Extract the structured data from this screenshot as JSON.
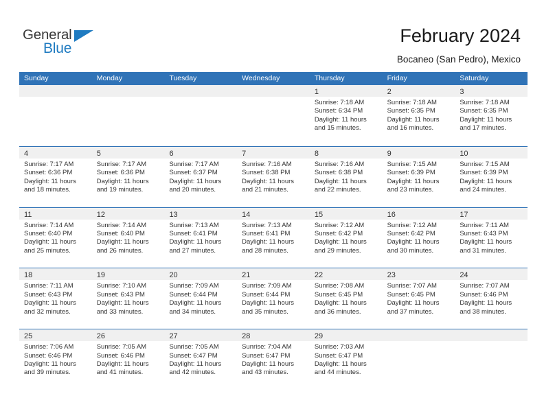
{
  "logo": {
    "word_top": "General",
    "word_bottom": "Blue",
    "accent_color": "#1f7bc1"
  },
  "header": {
    "title": "February 2024",
    "subtitle": "Bocaneo (San Pedro), Mexico"
  },
  "theme": {
    "header_blue": "#3073b7",
    "day_band_gray": "#f0f0f0",
    "text": "#333333"
  },
  "calendar": {
    "weekday_headers": [
      "Sunday",
      "Monday",
      "Tuesday",
      "Wednesday",
      "Thursday",
      "Friday",
      "Saturday"
    ],
    "weeks": [
      [
        {
          "day": "",
          "empty": true
        },
        {
          "day": "",
          "empty": true
        },
        {
          "day": "",
          "empty": true
        },
        {
          "day": "",
          "empty": true
        },
        {
          "day": "1",
          "sunrise": "Sunrise: 7:18 AM",
          "sunset": "Sunset: 6:34 PM",
          "daylight_1": "Daylight: 11 hours",
          "daylight_2": "and 15 minutes."
        },
        {
          "day": "2",
          "sunrise": "Sunrise: 7:18 AM",
          "sunset": "Sunset: 6:35 PM",
          "daylight_1": "Daylight: 11 hours",
          "daylight_2": "and 16 minutes."
        },
        {
          "day": "3",
          "sunrise": "Sunrise: 7:18 AM",
          "sunset": "Sunset: 6:35 PM",
          "daylight_1": "Daylight: 11 hours",
          "daylight_2": "and 17 minutes."
        }
      ],
      [
        {
          "day": "4",
          "sunrise": "Sunrise: 7:17 AM",
          "sunset": "Sunset: 6:36 PM",
          "daylight_1": "Daylight: 11 hours",
          "daylight_2": "and 18 minutes."
        },
        {
          "day": "5",
          "sunrise": "Sunrise: 7:17 AM",
          "sunset": "Sunset: 6:36 PM",
          "daylight_1": "Daylight: 11 hours",
          "daylight_2": "and 19 minutes."
        },
        {
          "day": "6",
          "sunrise": "Sunrise: 7:17 AM",
          "sunset": "Sunset: 6:37 PM",
          "daylight_1": "Daylight: 11 hours",
          "daylight_2": "and 20 minutes."
        },
        {
          "day": "7",
          "sunrise": "Sunrise: 7:16 AM",
          "sunset": "Sunset: 6:38 PM",
          "daylight_1": "Daylight: 11 hours",
          "daylight_2": "and 21 minutes."
        },
        {
          "day": "8",
          "sunrise": "Sunrise: 7:16 AM",
          "sunset": "Sunset: 6:38 PM",
          "daylight_1": "Daylight: 11 hours",
          "daylight_2": "and 22 minutes."
        },
        {
          "day": "9",
          "sunrise": "Sunrise: 7:15 AM",
          "sunset": "Sunset: 6:39 PM",
          "daylight_1": "Daylight: 11 hours",
          "daylight_2": "and 23 minutes."
        },
        {
          "day": "10",
          "sunrise": "Sunrise: 7:15 AM",
          "sunset": "Sunset: 6:39 PM",
          "daylight_1": "Daylight: 11 hours",
          "daylight_2": "and 24 minutes."
        }
      ],
      [
        {
          "day": "11",
          "sunrise": "Sunrise: 7:14 AM",
          "sunset": "Sunset: 6:40 PM",
          "daylight_1": "Daylight: 11 hours",
          "daylight_2": "and 25 minutes."
        },
        {
          "day": "12",
          "sunrise": "Sunrise: 7:14 AM",
          "sunset": "Sunset: 6:40 PM",
          "daylight_1": "Daylight: 11 hours",
          "daylight_2": "and 26 minutes."
        },
        {
          "day": "13",
          "sunrise": "Sunrise: 7:13 AM",
          "sunset": "Sunset: 6:41 PM",
          "daylight_1": "Daylight: 11 hours",
          "daylight_2": "and 27 minutes."
        },
        {
          "day": "14",
          "sunrise": "Sunrise: 7:13 AM",
          "sunset": "Sunset: 6:41 PM",
          "daylight_1": "Daylight: 11 hours",
          "daylight_2": "and 28 minutes."
        },
        {
          "day": "15",
          "sunrise": "Sunrise: 7:12 AM",
          "sunset": "Sunset: 6:42 PM",
          "daylight_1": "Daylight: 11 hours",
          "daylight_2": "and 29 minutes."
        },
        {
          "day": "16",
          "sunrise": "Sunrise: 7:12 AM",
          "sunset": "Sunset: 6:42 PM",
          "daylight_1": "Daylight: 11 hours",
          "daylight_2": "and 30 minutes."
        },
        {
          "day": "17",
          "sunrise": "Sunrise: 7:11 AM",
          "sunset": "Sunset: 6:43 PM",
          "daylight_1": "Daylight: 11 hours",
          "daylight_2": "and 31 minutes."
        }
      ],
      [
        {
          "day": "18",
          "sunrise": "Sunrise: 7:11 AM",
          "sunset": "Sunset: 6:43 PM",
          "daylight_1": "Daylight: 11 hours",
          "daylight_2": "and 32 minutes."
        },
        {
          "day": "19",
          "sunrise": "Sunrise: 7:10 AM",
          "sunset": "Sunset: 6:43 PM",
          "daylight_1": "Daylight: 11 hours",
          "daylight_2": "and 33 minutes."
        },
        {
          "day": "20",
          "sunrise": "Sunrise: 7:09 AM",
          "sunset": "Sunset: 6:44 PM",
          "daylight_1": "Daylight: 11 hours",
          "daylight_2": "and 34 minutes."
        },
        {
          "day": "21",
          "sunrise": "Sunrise: 7:09 AM",
          "sunset": "Sunset: 6:44 PM",
          "daylight_1": "Daylight: 11 hours",
          "daylight_2": "and 35 minutes."
        },
        {
          "day": "22",
          "sunrise": "Sunrise: 7:08 AM",
          "sunset": "Sunset: 6:45 PM",
          "daylight_1": "Daylight: 11 hours",
          "daylight_2": "and 36 minutes."
        },
        {
          "day": "23",
          "sunrise": "Sunrise: 7:07 AM",
          "sunset": "Sunset: 6:45 PM",
          "daylight_1": "Daylight: 11 hours",
          "daylight_2": "and 37 minutes."
        },
        {
          "day": "24",
          "sunrise": "Sunrise: 7:07 AM",
          "sunset": "Sunset: 6:46 PM",
          "daylight_1": "Daylight: 11 hours",
          "daylight_2": "and 38 minutes."
        }
      ],
      [
        {
          "day": "25",
          "sunrise": "Sunrise: 7:06 AM",
          "sunset": "Sunset: 6:46 PM",
          "daylight_1": "Daylight: 11 hours",
          "daylight_2": "and 39 minutes."
        },
        {
          "day": "26",
          "sunrise": "Sunrise: 7:05 AM",
          "sunset": "Sunset: 6:46 PM",
          "daylight_1": "Daylight: 11 hours",
          "daylight_2": "and 41 minutes."
        },
        {
          "day": "27",
          "sunrise": "Sunrise: 7:05 AM",
          "sunset": "Sunset: 6:47 PM",
          "daylight_1": "Daylight: 11 hours",
          "daylight_2": "and 42 minutes."
        },
        {
          "day": "28",
          "sunrise": "Sunrise: 7:04 AM",
          "sunset": "Sunset: 6:47 PM",
          "daylight_1": "Daylight: 11 hours",
          "daylight_2": "and 43 minutes."
        },
        {
          "day": "29",
          "sunrise": "Sunrise: 7:03 AM",
          "sunset": "Sunset: 6:47 PM",
          "daylight_1": "Daylight: 11 hours",
          "daylight_2": "and 44 minutes."
        },
        {
          "day": "",
          "empty": true
        },
        {
          "day": "",
          "empty": true
        }
      ]
    ]
  }
}
